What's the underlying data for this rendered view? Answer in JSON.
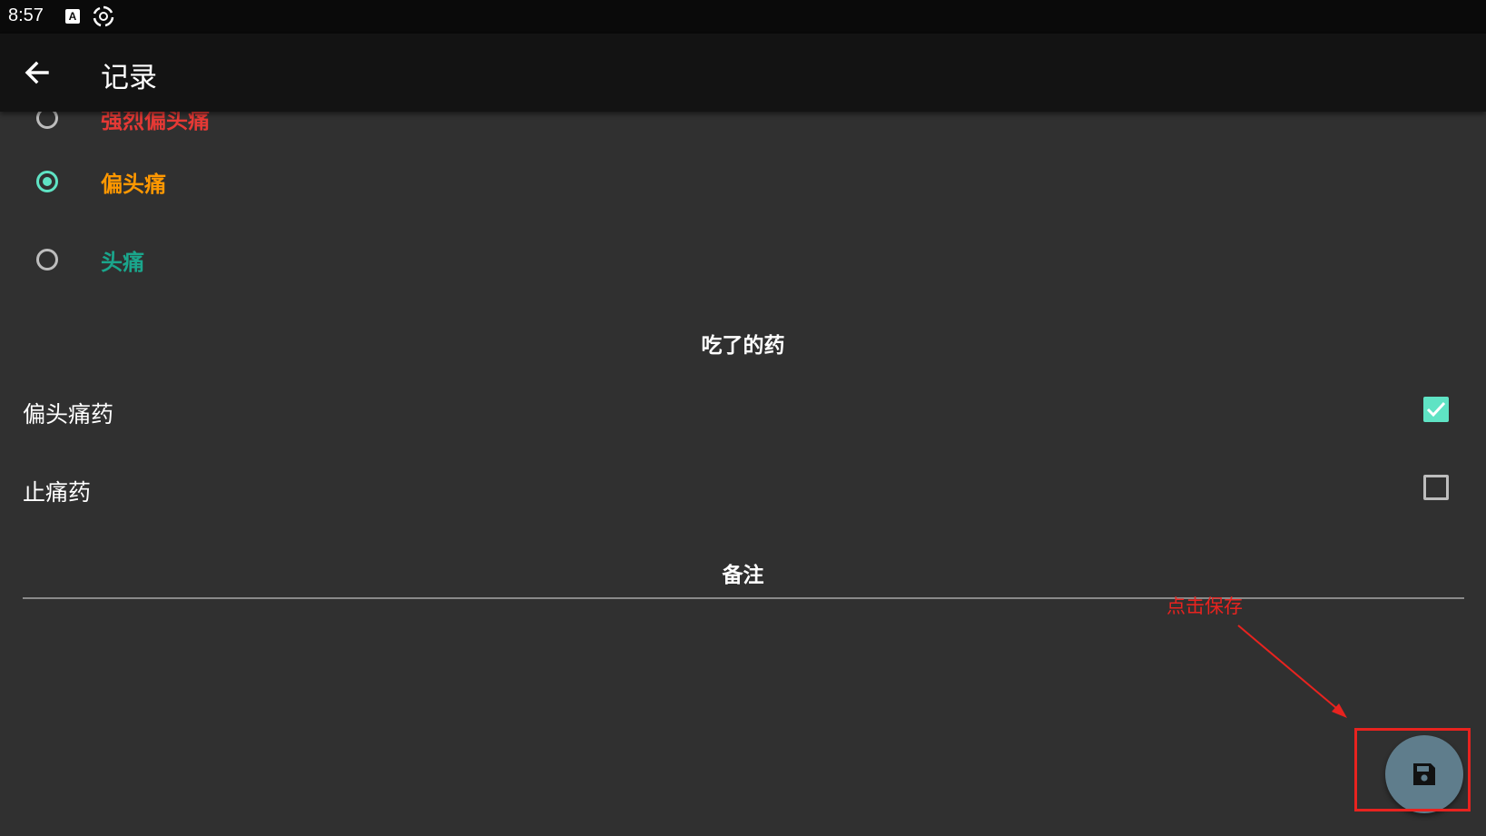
{
  "status_bar": {
    "time": "8:57",
    "icons": [
      "keyboard-a-icon",
      "sync-icon"
    ]
  },
  "app_bar": {
    "title": "记录",
    "back_icon": "back-arrow-icon"
  },
  "headache_types": [
    {
      "label": "强烈偏头痛",
      "selected": false,
      "color": "#e53935"
    },
    {
      "label": "偏头痛",
      "selected": true,
      "color": "#ff9800"
    },
    {
      "label": "头痛",
      "selected": false,
      "color": "#1aa68c"
    }
  ],
  "medication_section": {
    "header": "吃了的药",
    "items": [
      {
        "label": "偏头痛药",
        "checked": true
      },
      {
        "label": "止痛药",
        "checked": false
      }
    ]
  },
  "notes_section": {
    "header": "备注",
    "value": ""
  },
  "annotation": {
    "text": "点击保存",
    "color": "#e8231f"
  },
  "fab": {
    "icon": "save-floppy-icon",
    "color": "#5f7d8c"
  },
  "accent_color": "#5fe3c4"
}
